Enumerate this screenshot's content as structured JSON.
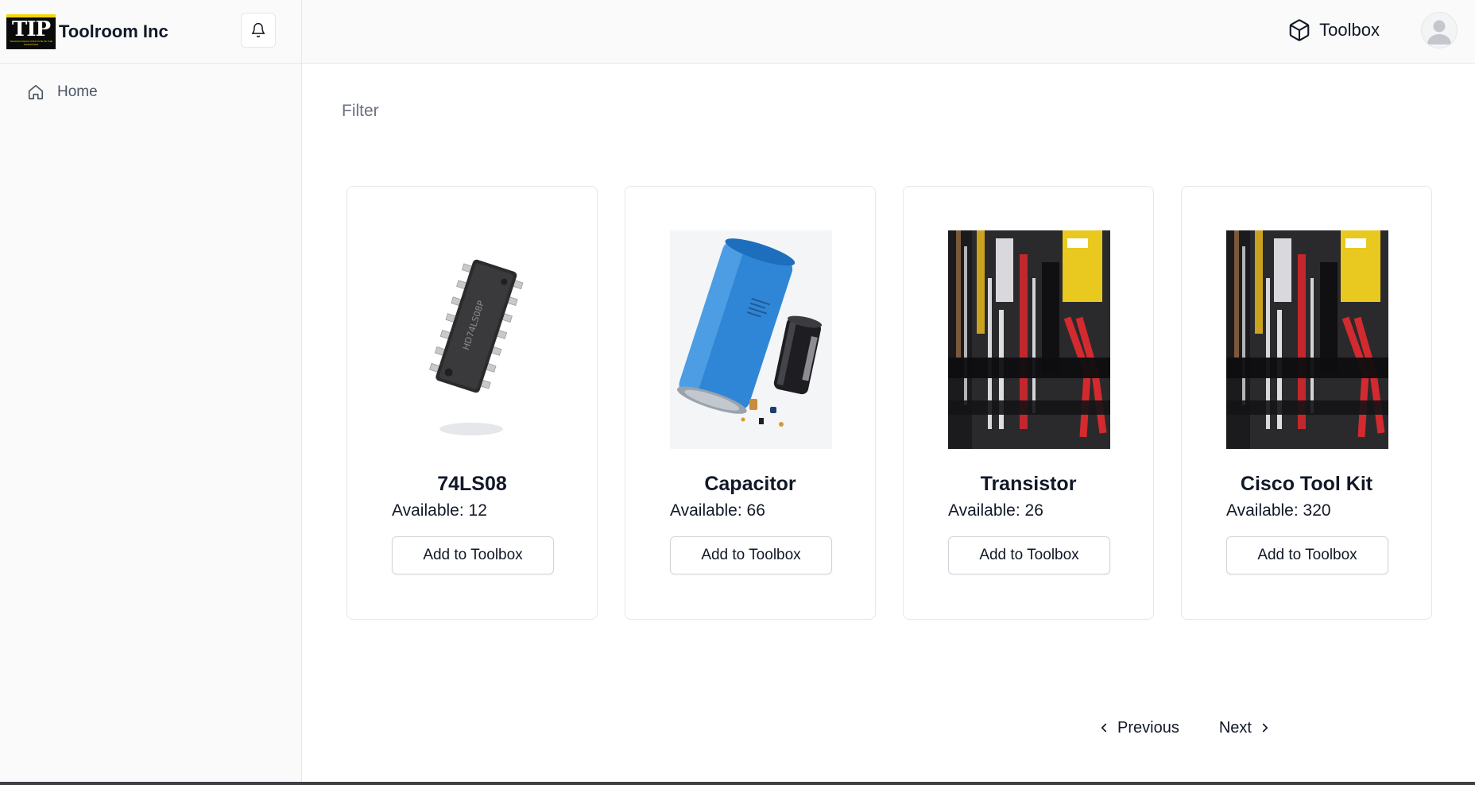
{
  "sidebar": {
    "logo": {
      "text": "TIP",
      "subtext": "TECHNOLOGICAL INSTITUTE OF THE PHILIPPINES"
    },
    "brand_name": "Toolroom Inc",
    "notifications_icon": "bell-icon",
    "nav": [
      {
        "label": "Home",
        "icon": "home-icon"
      }
    ]
  },
  "topbar": {
    "toolbox_label": "Toolbox",
    "toolbox_icon": "cube-icon",
    "avatar_icon": "user-avatar-icon"
  },
  "main": {
    "filter_label": "Filter",
    "products": [
      {
        "name": "74LS08",
        "available": "Available: 12",
        "button": "Add to Toolbox",
        "image": "ic-chip-image"
      },
      {
        "name": "Capacitor",
        "available": "Available: 66",
        "button": "Add to Toolbox",
        "image": "capacitor-image"
      },
      {
        "name": "Transistor",
        "available": "Available: 26",
        "button": "Add to Toolbox",
        "image": "tool-kit-image"
      },
      {
        "name": "Cisco Tool Kit",
        "available": "Available: 320",
        "button": "Add to Toolbox",
        "image": "tool-kit-image"
      }
    ],
    "pagination": {
      "previous": "Previous",
      "next": "Next"
    }
  },
  "colors": {
    "sidebar_bg": "#fafafa",
    "border": "#e5e7eb",
    "text": "#111827",
    "muted": "#6b7280",
    "logo_accent": "#f4d600"
  }
}
